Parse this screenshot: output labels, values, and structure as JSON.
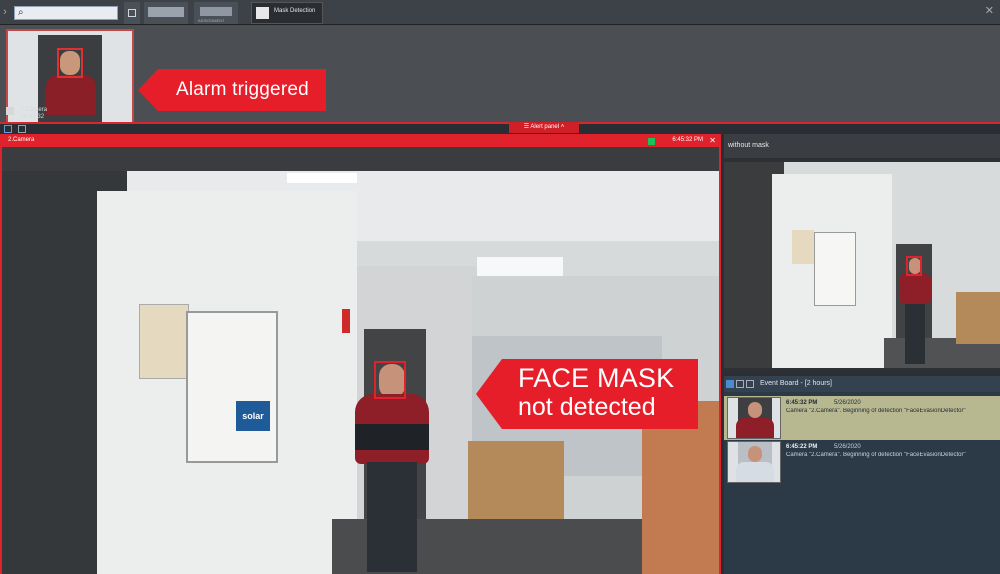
{
  "toolbar": {
    "search_value": "",
    "tab_thumb2_label": "ASSIGNMENT",
    "active_tab_label": "Mask Detection"
  },
  "alarm": {
    "camera_name": "2.Camera",
    "camera_time": "16:45:32",
    "callout": "Alarm triggered"
  },
  "alert_panel": {
    "label": "Alert panel"
  },
  "main_view": {
    "camera_label": "2.Camera",
    "time": "6:45:32 PM",
    "callout_line1": "FACE MASK",
    "callout_line2": "not detected",
    "board_logo": "solar"
  },
  "side_view": {
    "title": "without mask"
  },
  "event_board": {
    "title": "Event Board - [2 hours]",
    "events": [
      {
        "time": "6:45:32 PM",
        "date": "5/26/2020",
        "desc": "Camera \"2.Camera\". Beginning of detection \"FaceEvasionDetector\""
      },
      {
        "time": "6:45:22 PM",
        "date": "5/26/2020",
        "desc": "Camera \"2.Camera\". Beginning of detection \"FaceEvasionDetector\""
      }
    ]
  },
  "colors": {
    "alarm_red": "#e61e2a",
    "frame_red": "#e0222c",
    "event_highlight": "#b7b890"
  }
}
